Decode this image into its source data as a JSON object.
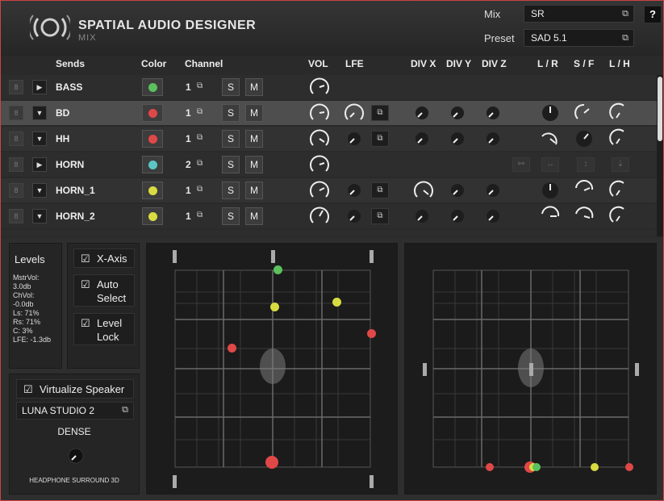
{
  "header": {
    "title": "SPATIAL AUDIO DESIGNER",
    "subtitle": "MIX",
    "mix_label": "Mix",
    "mix_value": "SR",
    "preset_label": "Preset",
    "preset_value": "SAD 5.1",
    "help_label": "?"
  },
  "columns": {
    "sends": "Sends",
    "color": "Color",
    "channel": "Channel",
    "vol": "VOL",
    "lfe": "LFE",
    "divx": "DIV X",
    "divy": "DIV Y",
    "divz": "DIV Z",
    "lr": "L / R",
    "sf": "S / F",
    "lh": "L / H"
  },
  "rows": [
    {
      "name": "BASS",
      "color": "#5cc05c",
      "channel": "1",
      "solo": "S",
      "mute": "M"
    },
    {
      "name": "BD",
      "color": "#e04848",
      "channel": "1",
      "solo": "S",
      "mute": "M"
    },
    {
      "name": "HH",
      "color": "#e04848",
      "channel": "1",
      "solo": "S",
      "mute": "M"
    },
    {
      "name": "HORN",
      "color": "#5cc6c6",
      "channel": "2",
      "solo": "S",
      "mute": "M"
    },
    {
      "name": "HORN_1",
      "color": "#d8dc40",
      "channel": "1",
      "solo": "S",
      "mute": "M"
    },
    {
      "name": "HORN_2",
      "color": "#d8dc40",
      "channel": "1",
      "solo": "S",
      "mute": "M"
    }
  ],
  "levels": {
    "title": "Levels",
    "lines": [
      "MstrVol:",
      " 3.0db",
      "ChVol:",
      " -0.0db",
      "Ls: 71%",
      "Rs: 71%",
      "C: 3%",
      "LFE: -1.3db"
    ]
  },
  "checks": {
    "xaxis": "X-Axis",
    "auto_select_1": "Auto",
    "auto_select_2": "Select",
    "level_lock_1": "Level",
    "level_lock_2": "Lock",
    "checkmark": "☑"
  },
  "virtualize": {
    "label": "Virtualize Speaker",
    "device": "LUNA STUDIO 2",
    "mode": "DENSE",
    "footer": "HEADPHONE SURROUND 3D"
  },
  "colors": {
    "red": "#e04848",
    "green": "#5cc05c",
    "yellow": "#d8dc40",
    "cyan": "#5cc6c6"
  }
}
